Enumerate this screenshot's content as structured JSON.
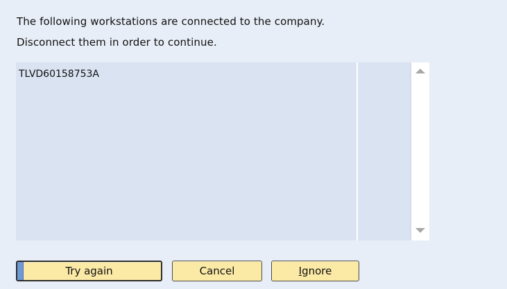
{
  "message": {
    "line1": "The following workstations are connected to the company.",
    "line2": "Disconnect them in order to continue."
  },
  "workstations": {
    "items": [
      "TLVD60158753A"
    ]
  },
  "scrollbar": {
    "up_icon": "chevron-up-icon",
    "down_icon": "chevron-down-icon"
  },
  "buttons": {
    "try_again": "Try again",
    "cancel": "Cancel",
    "ignore_mnemonic": "I",
    "ignore_rest": "gnore"
  },
  "colors": {
    "dialog_background": "#e8eef7",
    "list_background": "#d9e3f2",
    "button_background": "#fbe9a6",
    "focus_accent": "#6e98d6"
  }
}
